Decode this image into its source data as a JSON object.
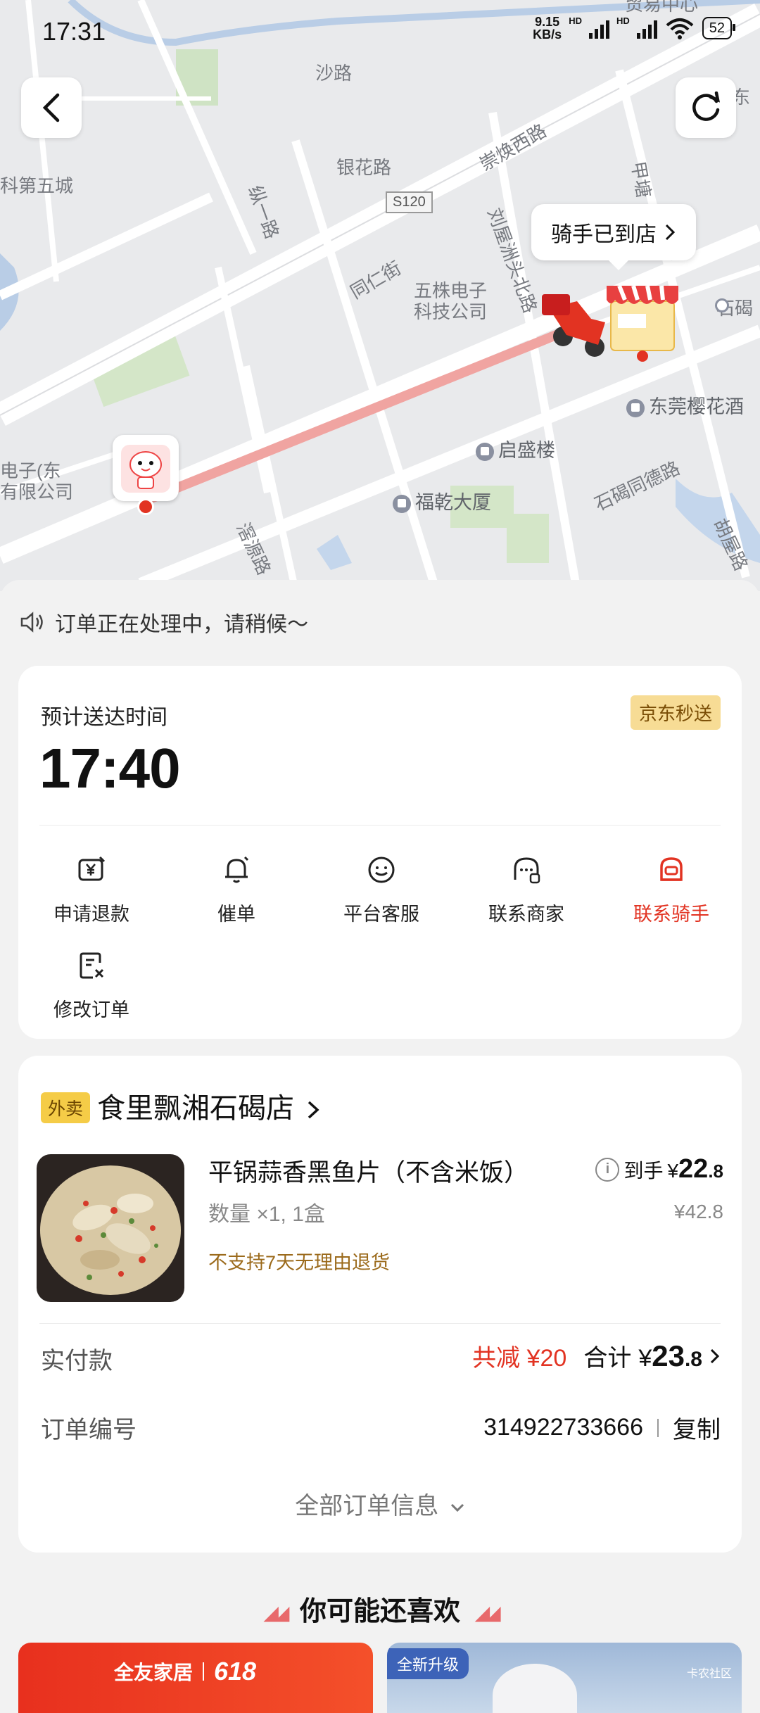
{
  "status_bar": {
    "time": "17:31",
    "net_speed_value": "9.15",
    "net_speed_unit": "KB/s",
    "hd1": "HD",
    "hd2": "HD",
    "battery": "52"
  },
  "map": {
    "labels": {
      "shalu": "沙路",
      "yinhualu": "银花路",
      "zong1lu": "纵一路",
      "s120": "S120",
      "chonghuanxilu": "崇焕西路",
      "tongrenjie": "同仁街",
      "liuwu": "刘屋洲头北路",
      "wuzhu": "五株电子\n科技公司",
      "kediwucheng": "科第五城",
      "dianzi": "电子(东\n有限公司",
      "qishenglou": "启盛楼",
      "fuqiandasha": "福乾大厦",
      "shijietongdelu": "石碣同德路",
      "ziyuanlu": "滘源路",
      "dongguanyinghua": "东莞樱花酒",
      "jiabang": "甲塘",
      "shijie": "石碣",
      "hulu": "胡屋路",
      "top_mid": "贸易中心",
      "right_top": "东"
    },
    "bubble_text": "骑手已到店",
    "route_color": "#f0a4a1"
  },
  "notice": {
    "text": "订单正在处理中，请稍候～"
  },
  "eta_card": {
    "label": "预计送达时间",
    "time": "17:40",
    "tag": "京东秒送",
    "actions": [
      {
        "label": "申请退款",
        "icon": "refund-icon"
      },
      {
        "label": "催单",
        "icon": "bell-icon"
      },
      {
        "label": "平台客服",
        "icon": "service-icon"
      },
      {
        "label": "联系商家",
        "icon": "merchant-icon"
      },
      {
        "label": "联系骑手",
        "icon": "rider-icon"
      },
      {
        "label": "修改订单",
        "icon": "edit-order-icon"
      }
    ]
  },
  "order_card": {
    "tag": "外卖",
    "shop_name": "食里飘湘石碣店",
    "item": {
      "name": "平锅蒜香黑鱼片（不含米饭）",
      "qty": "数量 ×1, 1盒",
      "warning": "不支持7天无理由退货",
      "price_label": "到手",
      "price_currency": "¥",
      "price_int": "22",
      "price_dec": ".8",
      "orig_price": "¥42.8"
    },
    "paid": {
      "label": "实付款",
      "discount": "共减 ¥20",
      "total_label": "合计",
      "total_currency": "¥",
      "total_int": "23",
      "total_dec": ".8"
    },
    "order_no": {
      "label": "订单编号",
      "value": "314922733666",
      "copy": "复制"
    },
    "more": "全部订单信息"
  },
  "recommend": {
    "title": "你可能还喜欢",
    "promo1_brand": "全友家居",
    "promo1_event": "618",
    "promo2_tag": "全新升级",
    "promo2_text": "卡农社区"
  }
}
